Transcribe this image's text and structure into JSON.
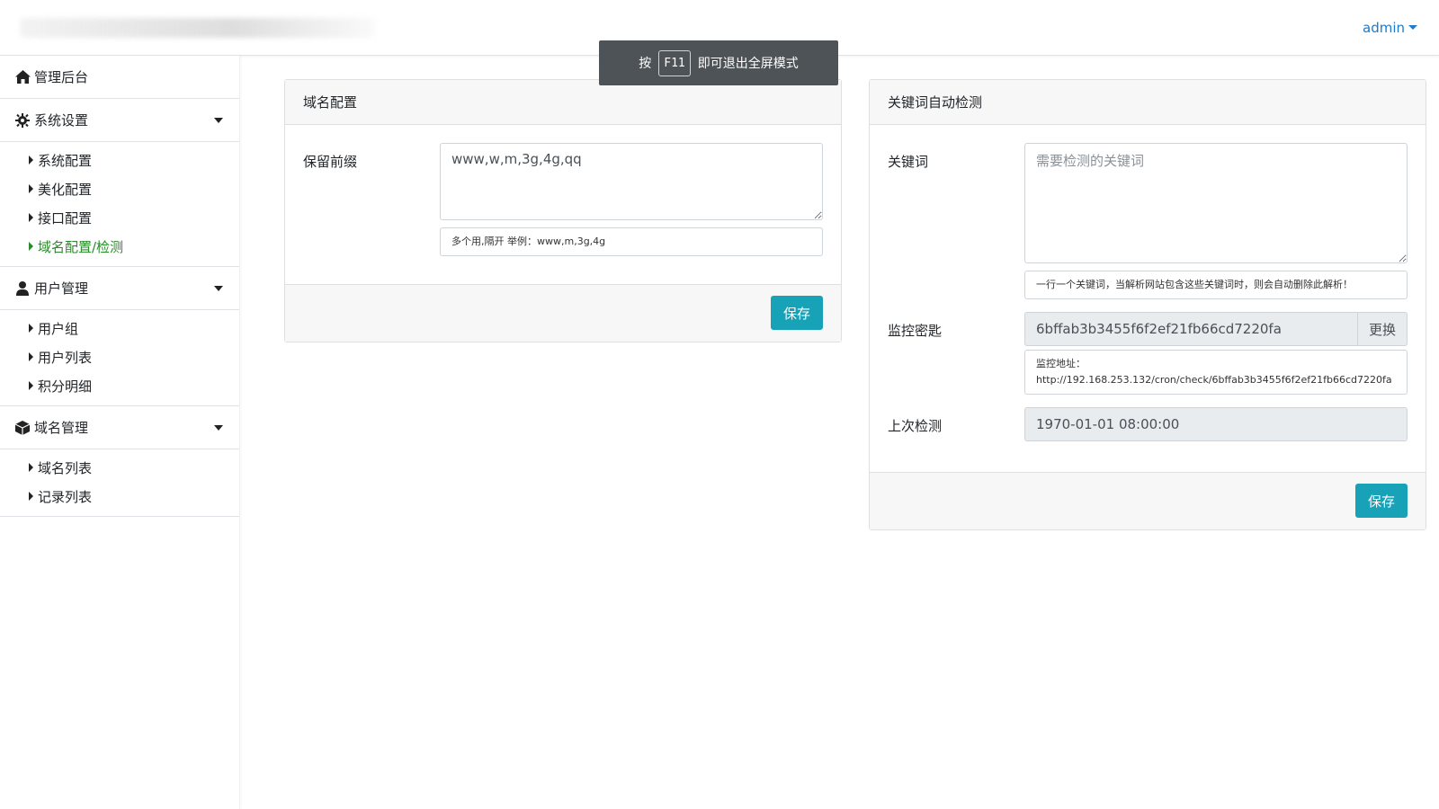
{
  "header": {
    "user_label": "admin"
  },
  "toast": {
    "prefix": "按",
    "key": "F11",
    "suffix": "即可退出全屏模式"
  },
  "sidebar": {
    "dashboard": {
      "label": "管理后台",
      "icon": "home-icon"
    },
    "groups": [
      {
        "label": "系统设置",
        "icon": "gear-icon",
        "items": [
          {
            "label": "系统配置",
            "active": false
          },
          {
            "label": "美化配置",
            "active": false
          },
          {
            "label": "接口配置",
            "active": false
          },
          {
            "label": "域名配置/检测",
            "active": true
          }
        ]
      },
      {
        "label": "用户管理",
        "icon": "user-icon",
        "items": [
          {
            "label": "用户组",
            "active": false
          },
          {
            "label": "用户列表",
            "active": false
          },
          {
            "label": "积分明细",
            "active": false
          }
        ]
      },
      {
        "label": "域名管理",
        "icon": "cube-icon",
        "items": [
          {
            "label": "域名列表",
            "active": false
          },
          {
            "label": "记录列表",
            "active": false
          }
        ]
      }
    ]
  },
  "domain_card": {
    "title": "域名配置",
    "prefix_label": "保留前缀",
    "prefix_value": "www,w,m,3g,4g,qq",
    "prefix_help": "多个用,隔开 举例：www,m,3g,4g",
    "save_label": "保存"
  },
  "keyword_card": {
    "title": "关键词自动检测",
    "keyword_label": "关键词",
    "keyword_placeholder": "需要检测的关键词",
    "keyword_help": "一行一个关键词，当解析网站包含这些关键词时，则会自动删除此解析！",
    "secret_label": "监控密匙",
    "secret_value": "6bffab3b3455f6f2ef21fb66cd7220fa",
    "replace_label": "更换",
    "monitor_title": "监控地址：",
    "monitor_url": "http://192.168.253.132/cron/check/6bffab3b3455f6f2ef21fb66cd7220fa",
    "last_check_label": "上次检测",
    "last_check_value": "1970-01-01 08:00:00",
    "save_label": "保存"
  },
  "colors": {
    "accent": "#17a2b8",
    "active_link": "#2a8a2a",
    "user_link": "#1f7ac9"
  }
}
